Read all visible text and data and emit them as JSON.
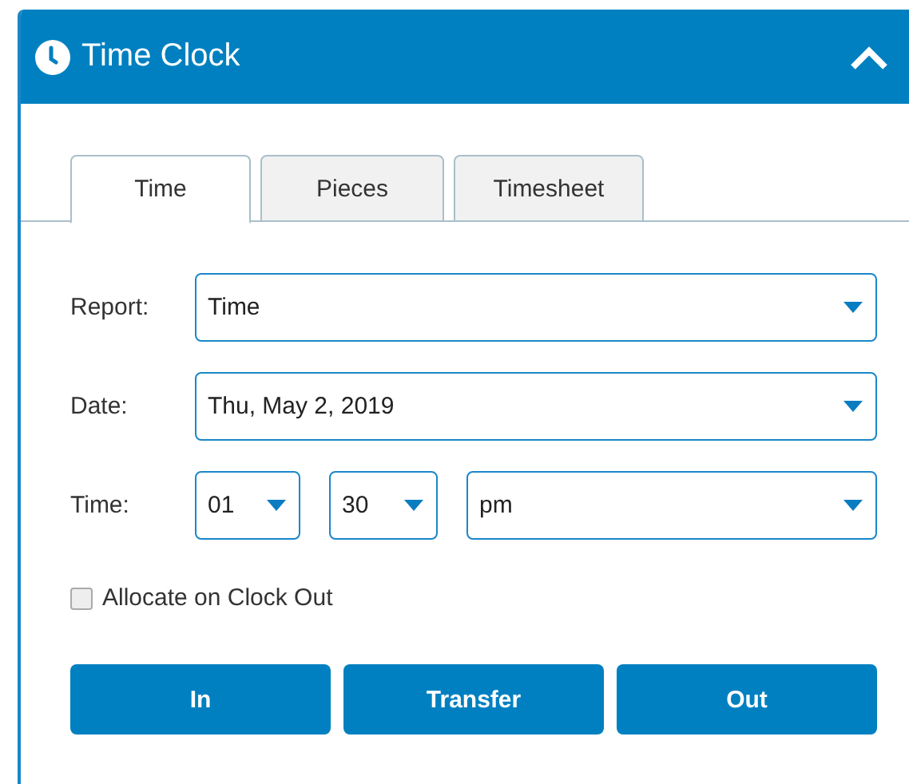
{
  "window": {
    "title": "Time Clock"
  },
  "tabs": [
    {
      "label": "Time",
      "selected": true
    },
    {
      "label": "Pieces",
      "selected": false
    },
    {
      "label": "Timesheet",
      "selected": false
    }
  ],
  "fields": [
    {
      "label": "Report:",
      "selects": [
        {
          "value": "Time"
        }
      ]
    },
    {
      "label": "Date:",
      "selects": [
        {
          "value": "Thu, May 2, 2019"
        }
      ]
    },
    {
      "label": "Time:",
      "selects": [
        {
          "value": "01"
        },
        {
          "value": "30"
        },
        {
          "value": "pm"
        }
      ]
    }
  ],
  "checkbox": {
    "label": "Allocate on Clock Out",
    "checked": false
  },
  "buttons": [
    "In",
    "Transfer",
    "Out"
  ]
}
